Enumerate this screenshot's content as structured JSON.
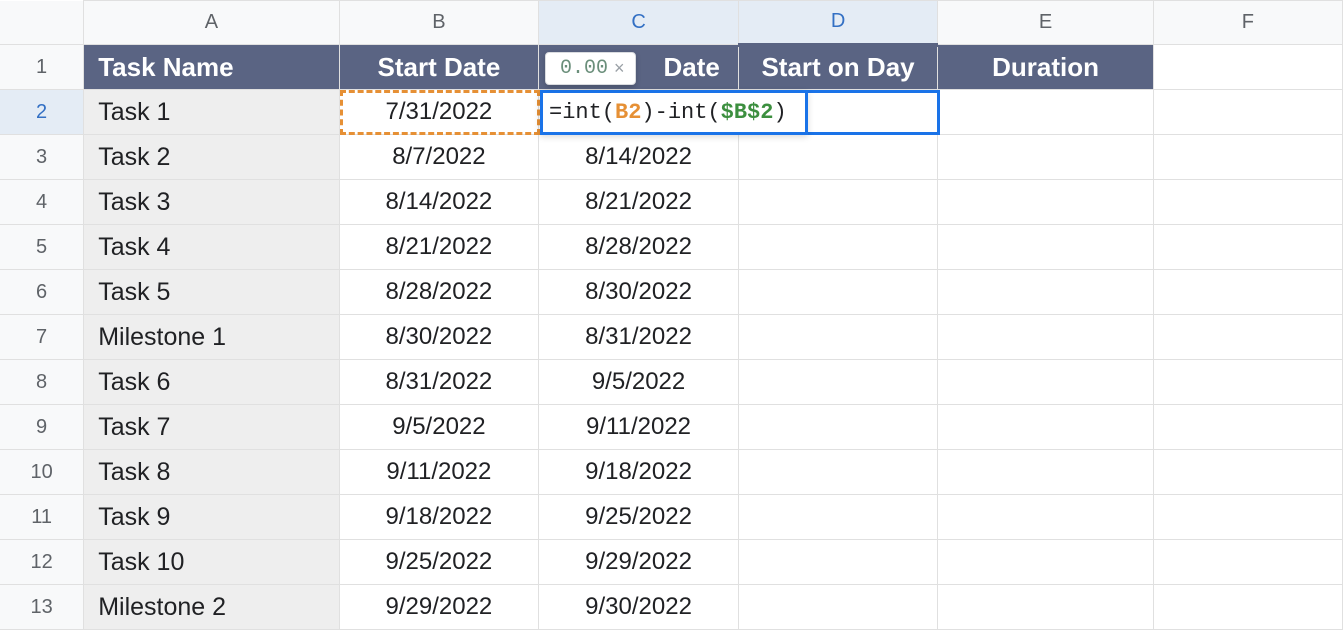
{
  "columns": [
    "A",
    "B",
    "C",
    "D",
    "E",
    "F"
  ],
  "row_numbers": [
    1,
    2,
    3,
    4,
    5,
    6,
    7,
    8,
    9,
    10,
    11,
    12,
    13
  ],
  "headers": {
    "A": "Task Name",
    "B": "Start Date",
    "C": "Date",
    "D": "Start on Day",
    "E": "Duration"
  },
  "rows": [
    {
      "task": "Task 1",
      "start": "7/31/2022",
      "end": ""
    },
    {
      "task": "Task 2",
      "start": "8/7/2022",
      "end": "8/14/2022"
    },
    {
      "task": "Task 3",
      "start": "8/14/2022",
      "end": "8/21/2022"
    },
    {
      "task": "Task 4",
      "start": "8/21/2022",
      "end": "8/28/2022"
    },
    {
      "task": "Task 5",
      "start": "8/28/2022",
      "end": "8/30/2022"
    },
    {
      "task": "Milestone 1",
      "start": "8/30/2022",
      "end": "8/31/2022"
    },
    {
      "task": "Task 6",
      "start": "8/31/2022",
      "end": "9/5/2022"
    },
    {
      "task": "Task 7",
      "start": "9/5/2022",
      "end": "9/11/2022"
    },
    {
      "task": "Task 8",
      "start": "9/11/2022",
      "end": "9/18/2022"
    },
    {
      "task": "Task 9",
      "start": "9/18/2022",
      "end": "9/25/2022"
    },
    {
      "task": "Task 10",
      "start": "9/25/2022",
      "end": "9/29/2022"
    },
    {
      "task": "Milestone 2",
      "start": "9/29/2022",
      "end": "9/30/2022"
    }
  ],
  "formula": {
    "prefix": "=int(",
    "ref1": "B2",
    "mid": ")-int(",
    "ref2": "$B$2",
    "suffix": ")"
  },
  "tooltip": {
    "value": "0.00",
    "close": "×"
  }
}
